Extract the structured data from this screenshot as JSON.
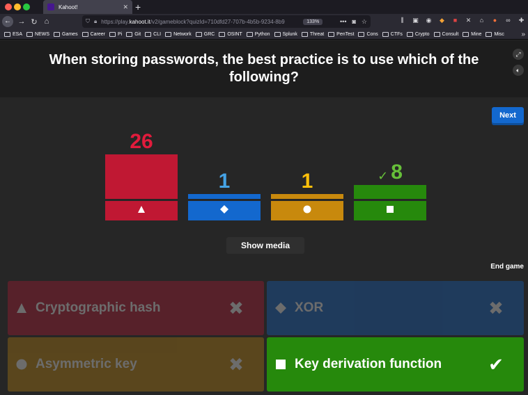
{
  "browser": {
    "tab_title": "Kahoot!",
    "url_host_prefix": "https://play.",
    "url_host": "kahoot.it",
    "url_path": "/v2/gameblock?quizId=710dfd27-707b-4b5b-9234-8b9",
    "zoom": "133%",
    "bookmarks": [
      "ESA",
      "NEWS",
      "Games",
      "Career",
      "Pi",
      "Git",
      "CLI",
      "Network",
      "GRC",
      "OSINT",
      "Python",
      "Splunk",
      "Threat",
      "PenTest",
      "Cons",
      "CTFs",
      "Crypto",
      "Consult",
      "Mine",
      "Misc"
    ]
  },
  "question": {
    "text": "When storing passwords, the best practice is to use which of the following?"
  },
  "controls": {
    "next_label": "Next",
    "show_media_label": "Show media",
    "end_game_label": "End game"
  },
  "colors": {
    "red": "#c01833",
    "blue": "#1368ce",
    "yellow": "#c8890d",
    "green": "#26890c",
    "count_red": "#e21b3c",
    "count_blue": "#45a3e5",
    "count_yellow": "#ffc00a",
    "count_green": "#66bf39"
  },
  "chart_data": {
    "type": "bar",
    "categories": [
      "Cryptographic hash",
      "XOR",
      "Asymmetric key",
      "Key derivation function"
    ],
    "values": [
      26,
      1,
      1,
      8
    ],
    "correct": [
      false,
      false,
      false,
      true
    ],
    "ylim": [
      0,
      26
    ]
  },
  "answers": [
    {
      "text": "Cryptographic hash",
      "shape": "triangle",
      "correct": false
    },
    {
      "text": "XOR",
      "shape": "diamond",
      "correct": false
    },
    {
      "text": "Asymmetric key",
      "shape": "circle",
      "correct": false
    },
    {
      "text": "Key derivation function",
      "shape": "square",
      "correct": true
    }
  ]
}
